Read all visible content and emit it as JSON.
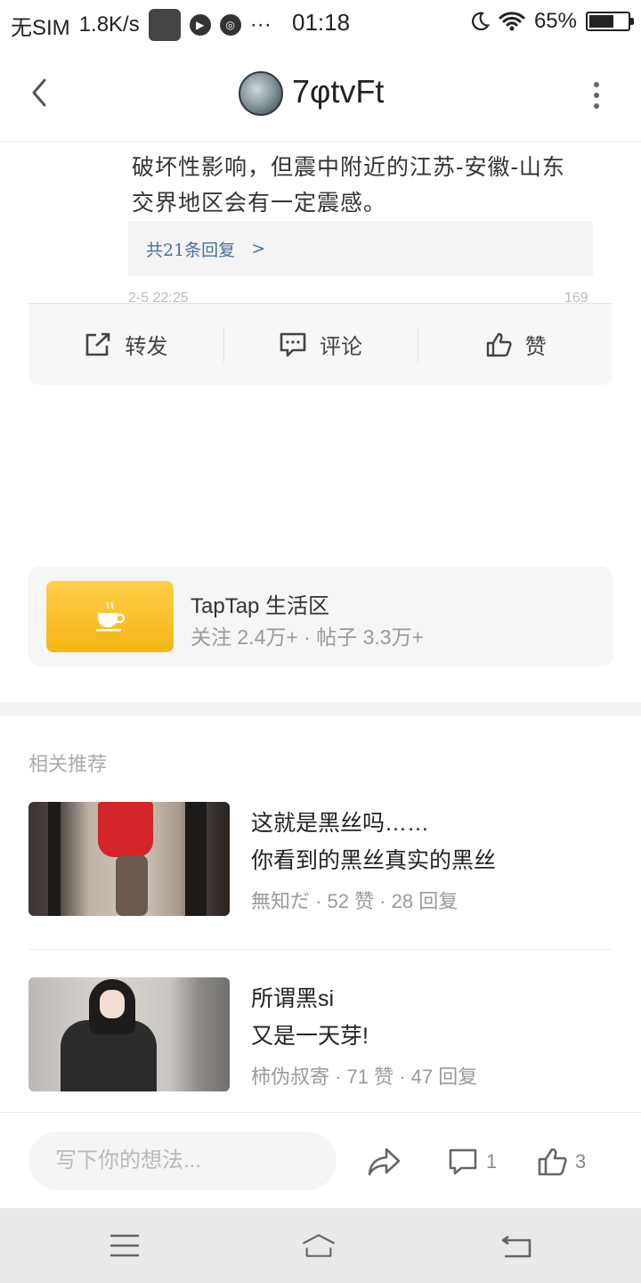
{
  "status_bar": {
    "carrier": "无SIM",
    "speed": "1.8K/s",
    "dots": "···",
    "time": "01:18",
    "battery": "65%",
    "battery_level": 0.65
  },
  "header": {
    "title": "7φtvFt"
  },
  "embedded_post": {
    "text_line1": "破坏性影响，但震中附近的江苏-安徽-山东",
    "text_line2": "交界地区会有一定震感。",
    "replies_label": "共21条回复",
    "replies_chevron": ">",
    "cut_row_text": "2-5 22:25",
    "cut_row_count": "169",
    "actions": [
      {
        "label": "转发",
        "icon": "share-icon"
      },
      {
        "label": "评论",
        "icon": "comment-icon"
      },
      {
        "label": "赞",
        "icon": "thumbs-up-icon"
      }
    ]
  },
  "community": {
    "name": "TapTap 生活区",
    "stats": "关注 2.4万+  ·  帖子 3.3万+",
    "icon": "coffee-cup-icon"
  },
  "related": {
    "title": "相关推荐",
    "items": [
      {
        "title_line1": "这就是黑丝吗……",
        "title_line2": "你看到的黑丝真实的黑丝",
        "meta": "無知だ  ·  52 赞  ·  28 回复"
      },
      {
        "title_line1": "所谓黑si",
        "title_line2": "又是一天芽!",
        "meta": "柿伪叔寄  ·  71 赞  ·  47 回复"
      }
    ]
  },
  "bottom_bar": {
    "placeholder": "写下你的想法...",
    "comment_count": "1",
    "like_count": "3"
  },
  "colors": {
    "link_blue": "#4b6f98",
    "community_yellow": "#f4b414",
    "nav_bg": "#e9e9e9"
  }
}
